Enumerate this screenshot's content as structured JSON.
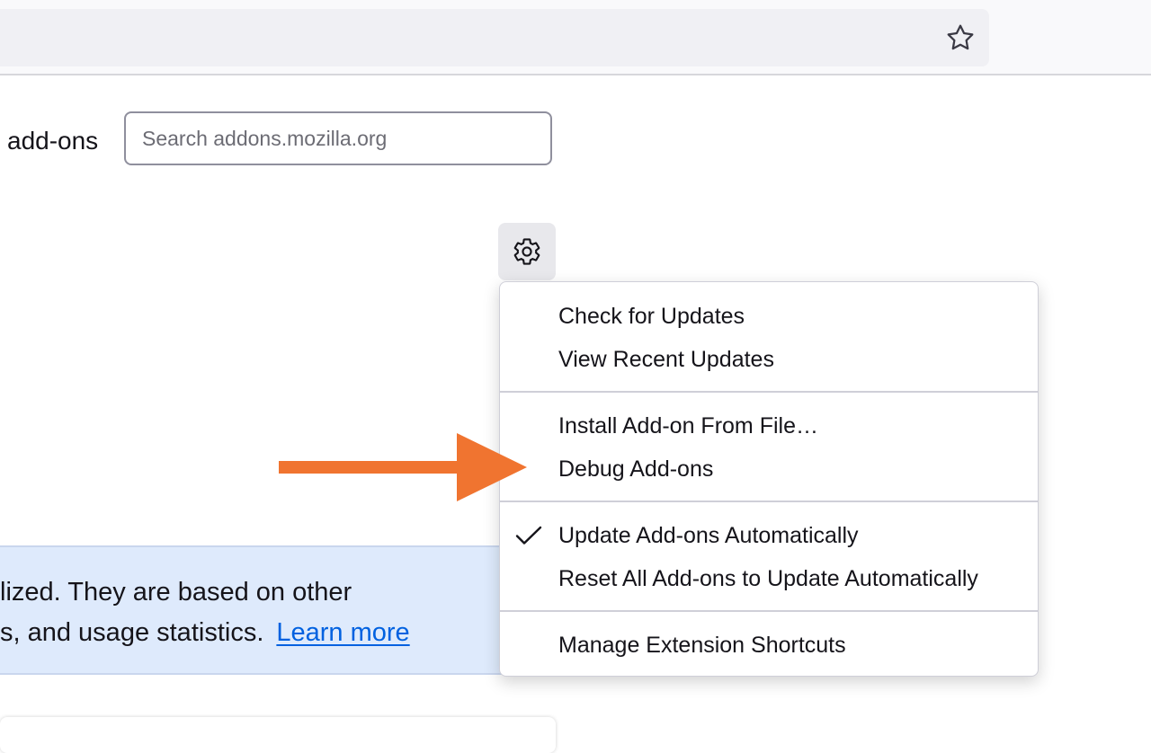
{
  "toolbar": {
    "star_icon": "star-outline-icon"
  },
  "main": {
    "heading_fragment": "add-ons",
    "search_placeholder": "Search addons.mozilla.org",
    "gear_icon": "gear-icon"
  },
  "menu": {
    "items": [
      {
        "label": "Check for Updates",
        "checked": false
      },
      {
        "label": "View Recent Updates",
        "checked": false
      },
      {
        "label": "Install Add-on From File…",
        "checked": false
      },
      {
        "label": "Debug Add-ons",
        "checked": false
      },
      {
        "label": "Update Add-ons Automatically",
        "checked": true
      },
      {
        "label": "Reset All Add-ons to Update Automatically",
        "checked": false
      },
      {
        "label": "Manage Extension Shortcuts",
        "checked": false
      }
    ]
  },
  "notice": {
    "line1": "lized. They are based on other",
    "line2": "s, and usage statistics.",
    "link": "Learn more"
  },
  "annotation": {
    "arrow_color": "#f07430",
    "points_to": "Debug Add-ons"
  },
  "colors": {
    "accent_link": "#0061e0",
    "notice_bg": "#deeafc"
  }
}
